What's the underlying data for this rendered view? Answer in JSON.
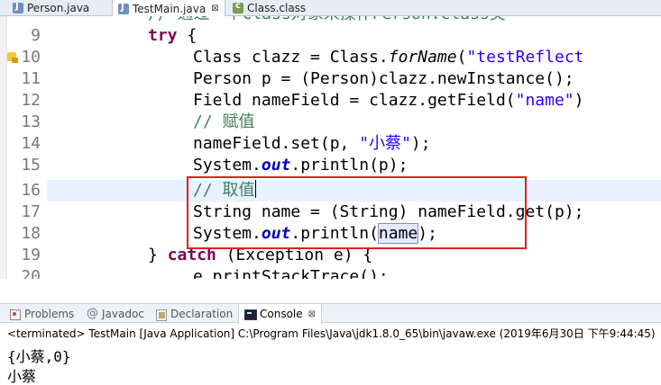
{
  "editor_tabs": [
    {
      "label": "Person.java",
      "active": false,
      "icon": "java-file-icon"
    },
    {
      "label": "TestMain.java",
      "active": true,
      "icon": "java-file-icon",
      "close": "⊠"
    },
    {
      "label": "Class.class",
      "active": false,
      "icon": "class-file-icon"
    }
  ],
  "code": {
    "line_numbers": [
      "9",
      "10",
      "11",
      "12",
      "13",
      "14",
      "15",
      "16",
      "17",
      "18",
      "19",
      "20"
    ],
    "top_partial_comment": "// 通过一个Class对象来操作Person.class类",
    "l9_kw": "try",
    "l9_rest": " {",
    "l10_a": "Class clazz = Class.",
    "l10_m": "forName",
    "l10_b": "(",
    "l10_str": "\"testReflect",
    "l11": "Person p = (Person)clazz.newInstance();",
    "l12_a": "Field nameField = clazz.getField(",
    "l12_str": "\"name\"",
    "l12_b": ")",
    "l13_cm": "// 赋值",
    "l14_a": "nameField.set(p, ",
    "l14_str": "\"小蔡\"",
    "l14_b": ");",
    "l15_a": "System.",
    "l15_fld": "out",
    "l15_b": ".println(p);",
    "l16_cm": "// 取值",
    "l17": "String name = (String) nameField.get(p);",
    "l18_a": "System.",
    "l18_fld": "out",
    "l18_b": ".println(",
    "l18_var": "name",
    "l18_c": ");",
    "l19_a": "} ",
    "l19_kw": "catch",
    "l19_b": " (Exception e) {",
    "l20": "e.printStackTrace();"
  },
  "view_tabs": [
    {
      "label": "Problems",
      "active": false
    },
    {
      "label": "Javadoc",
      "active": false
    },
    {
      "label": "Declaration",
      "active": false
    },
    {
      "label": "Console",
      "active": true,
      "close": "⊠"
    }
  ],
  "console": {
    "status": "<terminated> TestMain [Java Application] C:\\Program Files\\Java\\jdk1.8.0_65\\bin\\javaw.exe (2019年6月30日 下午9:44:45)",
    "lines": [
      "{小蔡,0}",
      "小蔡"
    ]
  }
}
